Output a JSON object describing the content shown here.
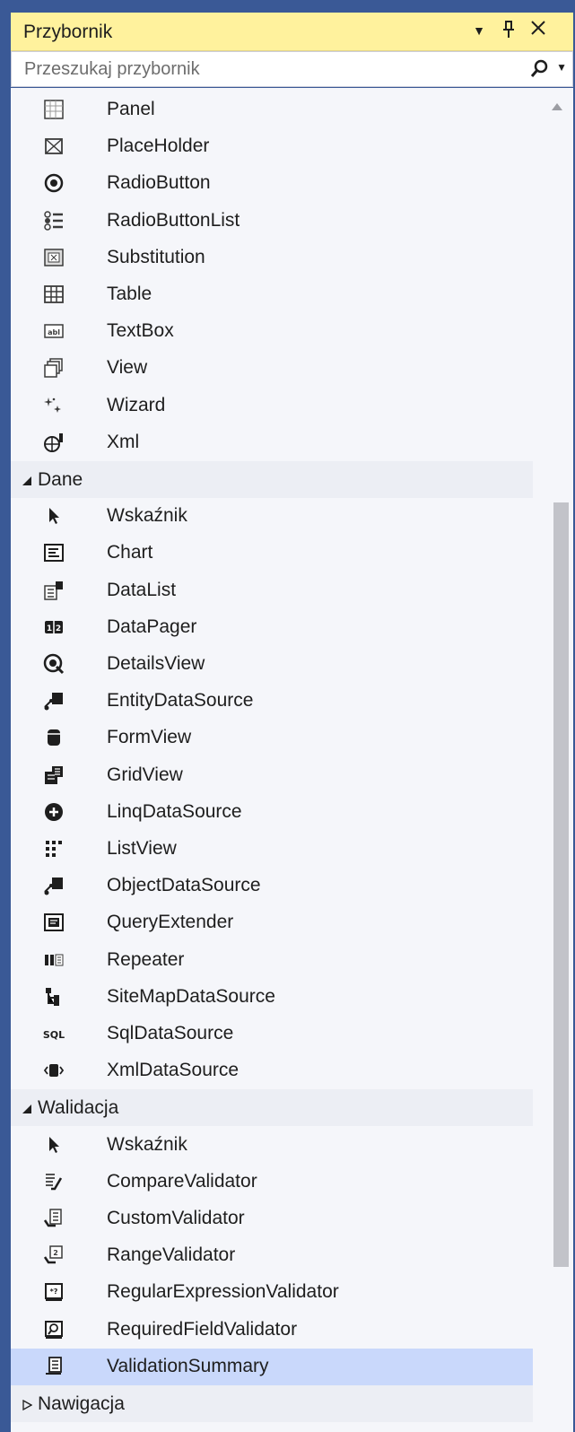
{
  "window": {
    "title": "Przybornik"
  },
  "search": {
    "placeholder": "Przeszukaj przybornik"
  },
  "rows": [
    {
      "type": "item",
      "label": "Panel",
      "icon": "panel-icon"
    },
    {
      "type": "item",
      "label": "PlaceHolder",
      "icon": "placeholder-icon"
    },
    {
      "type": "item",
      "label": "RadioButton",
      "icon": "radiobutton-icon"
    },
    {
      "type": "item",
      "label": "RadioButtonList",
      "icon": "radiobuttonlist-icon"
    },
    {
      "type": "item",
      "label": "Substitution",
      "icon": "substitution-icon"
    },
    {
      "type": "item",
      "label": "Table",
      "icon": "table-icon"
    },
    {
      "type": "item",
      "label": "TextBox",
      "icon": "textbox-icon"
    },
    {
      "type": "item",
      "label": "View",
      "icon": "view-icon"
    },
    {
      "type": "item",
      "label": "Wizard",
      "icon": "wizard-icon"
    },
    {
      "type": "item",
      "label": "Xml",
      "icon": "xml-icon"
    },
    {
      "type": "cat",
      "label": "Dane",
      "expanded": true
    },
    {
      "type": "item",
      "label": "Wskaźnik",
      "icon": "pointer-icon"
    },
    {
      "type": "item",
      "label": "Chart",
      "icon": "chart-icon"
    },
    {
      "type": "item",
      "label": "DataList",
      "icon": "datalist-icon"
    },
    {
      "type": "item",
      "label": "DataPager",
      "icon": "datapager-icon"
    },
    {
      "type": "item",
      "label": "DetailsView",
      "icon": "detailsview-icon"
    },
    {
      "type": "item",
      "label": "EntityDataSource",
      "icon": "entitydatasource-icon"
    },
    {
      "type": "item",
      "label": "FormView",
      "icon": "formview-icon"
    },
    {
      "type": "item",
      "label": "GridView",
      "icon": "gridview-icon"
    },
    {
      "type": "item",
      "label": "LinqDataSource",
      "icon": "linqdatasource-icon"
    },
    {
      "type": "item",
      "label": "ListView",
      "icon": "listview-icon"
    },
    {
      "type": "item",
      "label": "ObjectDataSource",
      "icon": "objectdatasource-icon"
    },
    {
      "type": "item",
      "label": "QueryExtender",
      "icon": "queryextender-icon"
    },
    {
      "type": "item",
      "label": "Repeater",
      "icon": "repeater-icon"
    },
    {
      "type": "item",
      "label": "SiteMapDataSource",
      "icon": "sitemapdatasource-icon"
    },
    {
      "type": "item",
      "label": "SqlDataSource",
      "icon": "sqldatasource-icon",
      "icon_text": "SQL"
    },
    {
      "type": "item",
      "label": "XmlDataSource",
      "icon": "xmldatasource-icon"
    },
    {
      "type": "cat",
      "label": "Walidacja",
      "expanded": true
    },
    {
      "type": "item",
      "label": "Wskaźnik",
      "icon": "pointer-icon"
    },
    {
      "type": "item",
      "label": "CompareValidator",
      "icon": "comparevalidator-icon"
    },
    {
      "type": "item",
      "label": "CustomValidator",
      "icon": "customvalidator-icon"
    },
    {
      "type": "item",
      "label": "RangeValidator",
      "icon": "rangevalidator-icon"
    },
    {
      "type": "item",
      "label": "RegularExpressionValidator",
      "icon": "regularexpressionvalidator-icon"
    },
    {
      "type": "item",
      "label": "RequiredFieldValidator",
      "icon": "requiredfieldvalidator-icon"
    },
    {
      "type": "item",
      "label": "ValidationSummary",
      "icon": "validationsummary-icon",
      "selected": true
    },
    {
      "type": "cat",
      "label": "Nawigacja",
      "expanded": false
    }
  ],
  "colors": {
    "title_bar": "#fff29d",
    "frame": "#3a5996",
    "selection": "#c9d8fb",
    "background": "#f5f6fa"
  }
}
